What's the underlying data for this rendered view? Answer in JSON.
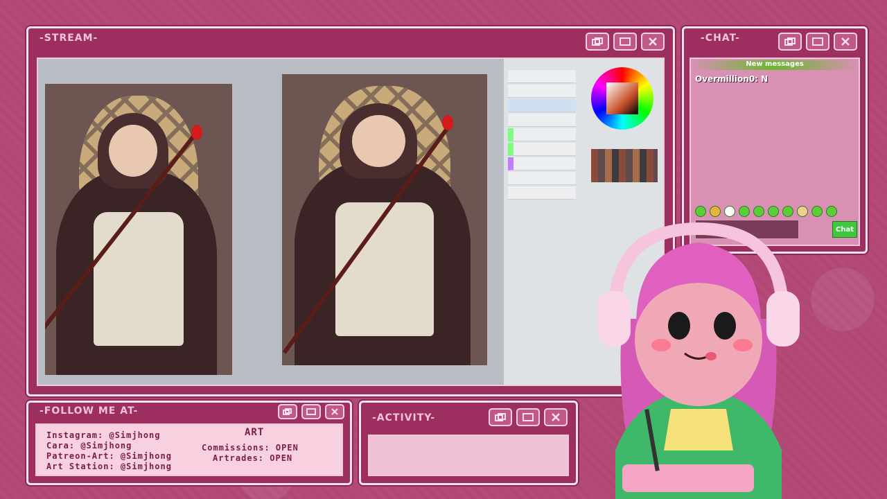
{
  "stream": {
    "title": "-STREAM-"
  },
  "chat": {
    "title": "-CHAT-",
    "new_messages_label": "New messages",
    "message": "Overmillion0: N",
    "send_label": "Chat"
  },
  "follow": {
    "title": "-FOLLOW ME AT-",
    "lines": [
      "Instagram: @Simjhong",
      "Cara: @Simjhong",
      "Patreon-Art: @Simjhong",
      "Art Station: @Simjhong"
    ],
    "art_heading": "ART",
    "commissions": "Commissions: OPEN",
    "artrades": "Artrades: OPEN"
  },
  "activity": {
    "title": "-ACTIVITY-"
  },
  "colors": {
    "frame": "#b54a78",
    "panel": "#9c2f5f",
    "accent_green": "#3fc83f"
  }
}
